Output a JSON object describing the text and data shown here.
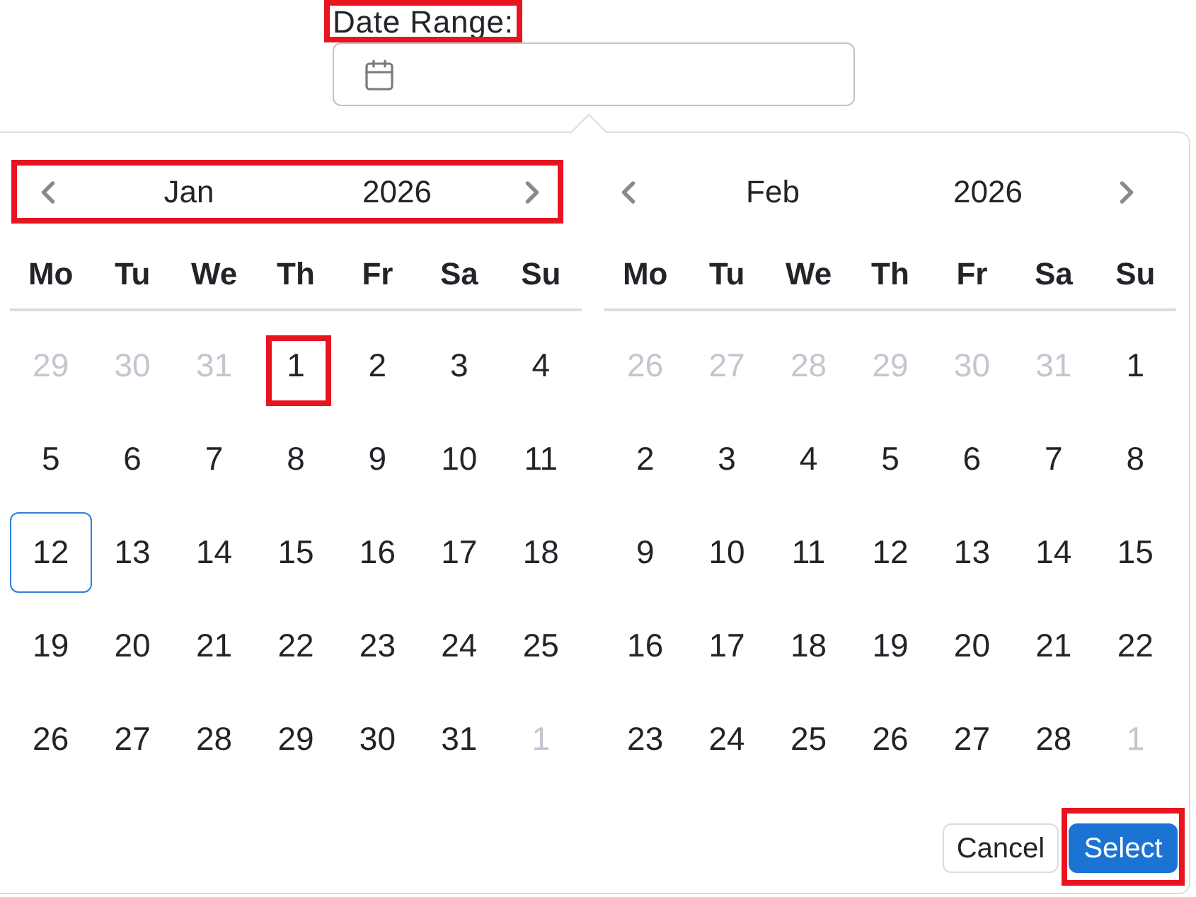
{
  "field": {
    "label": "Date Range:",
    "label_highlighted": true
  },
  "months": [
    {
      "month": "Jan",
      "year": "2026",
      "highlighted": true,
      "weekdays": [
        "Mo",
        "Tu",
        "We",
        "Th",
        "Fr",
        "Sa",
        "Su"
      ],
      "days": [
        {
          "day": "29",
          "outside": true,
          "current": false,
          "highlighted": false
        },
        {
          "day": "30",
          "outside": true,
          "current": false,
          "highlighted": false
        },
        {
          "day": "31",
          "outside": true,
          "current": false,
          "highlighted": false
        },
        {
          "day": "1",
          "outside": false,
          "current": false,
          "highlighted": true
        },
        {
          "day": "2",
          "outside": false,
          "current": false,
          "highlighted": false
        },
        {
          "day": "3",
          "outside": false,
          "current": false,
          "highlighted": false
        },
        {
          "day": "4",
          "outside": false,
          "current": false,
          "highlighted": false
        },
        {
          "day": "5",
          "outside": false,
          "current": false,
          "highlighted": false
        },
        {
          "day": "6",
          "outside": false,
          "current": false,
          "highlighted": false
        },
        {
          "day": "7",
          "outside": false,
          "current": false,
          "highlighted": false
        },
        {
          "day": "8",
          "outside": false,
          "current": false,
          "highlighted": false
        },
        {
          "day": "9",
          "outside": false,
          "current": false,
          "highlighted": false
        },
        {
          "day": "10",
          "outside": false,
          "current": false,
          "highlighted": false
        },
        {
          "day": "11",
          "outside": false,
          "current": false,
          "highlighted": false
        },
        {
          "day": "12",
          "outside": false,
          "current": true,
          "highlighted": false
        },
        {
          "day": "13",
          "outside": false,
          "current": false,
          "highlighted": false
        },
        {
          "day": "14",
          "outside": false,
          "current": false,
          "highlighted": false
        },
        {
          "day": "15",
          "outside": false,
          "current": false,
          "highlighted": false
        },
        {
          "day": "16",
          "outside": false,
          "current": false,
          "highlighted": false
        },
        {
          "day": "17",
          "outside": false,
          "current": false,
          "highlighted": false
        },
        {
          "day": "18",
          "outside": false,
          "current": false,
          "highlighted": false
        },
        {
          "day": "19",
          "outside": false,
          "current": false,
          "highlighted": false
        },
        {
          "day": "20",
          "outside": false,
          "current": false,
          "highlighted": false
        },
        {
          "day": "21",
          "outside": false,
          "current": false,
          "highlighted": false
        },
        {
          "day": "22",
          "outside": false,
          "current": false,
          "highlighted": false
        },
        {
          "day": "23",
          "outside": false,
          "current": false,
          "highlighted": false
        },
        {
          "day": "24",
          "outside": false,
          "current": false,
          "highlighted": false
        },
        {
          "day": "25",
          "outside": false,
          "current": false,
          "highlighted": false
        },
        {
          "day": "26",
          "outside": false,
          "current": false,
          "highlighted": false
        },
        {
          "day": "27",
          "outside": false,
          "current": false,
          "highlighted": false
        },
        {
          "day": "28",
          "outside": false,
          "current": false,
          "highlighted": false
        },
        {
          "day": "29",
          "outside": false,
          "current": false,
          "highlighted": false
        },
        {
          "day": "30",
          "outside": false,
          "current": false,
          "highlighted": false
        },
        {
          "day": "31",
          "outside": false,
          "current": false,
          "highlighted": false
        },
        {
          "day": "1",
          "outside": true,
          "current": false,
          "highlighted": false
        }
      ]
    },
    {
      "month": "Feb",
      "year": "2026",
      "highlighted": false,
      "weekdays": [
        "Mo",
        "Tu",
        "We",
        "Th",
        "Fr",
        "Sa",
        "Su"
      ],
      "days": [
        {
          "day": "26",
          "outside": true,
          "current": false,
          "highlighted": false
        },
        {
          "day": "27",
          "outside": true,
          "current": false,
          "highlighted": false
        },
        {
          "day": "28",
          "outside": true,
          "current": false,
          "highlighted": false
        },
        {
          "day": "29",
          "outside": true,
          "current": false,
          "highlighted": false
        },
        {
          "day": "30",
          "outside": true,
          "current": false,
          "highlighted": false
        },
        {
          "day": "31",
          "outside": true,
          "current": false,
          "highlighted": false
        },
        {
          "day": "1",
          "outside": false,
          "current": false,
          "highlighted": false
        },
        {
          "day": "2",
          "outside": false,
          "current": false,
          "highlighted": false
        },
        {
          "day": "3",
          "outside": false,
          "current": false,
          "highlighted": false
        },
        {
          "day": "4",
          "outside": false,
          "current": false,
          "highlighted": false
        },
        {
          "day": "5",
          "outside": false,
          "current": false,
          "highlighted": false
        },
        {
          "day": "6",
          "outside": false,
          "current": false,
          "highlighted": false
        },
        {
          "day": "7",
          "outside": false,
          "current": false,
          "highlighted": false
        },
        {
          "day": "8",
          "outside": false,
          "current": false,
          "highlighted": false
        },
        {
          "day": "9",
          "outside": false,
          "current": false,
          "highlighted": false
        },
        {
          "day": "10",
          "outside": false,
          "current": false,
          "highlighted": false
        },
        {
          "day": "11",
          "outside": false,
          "current": false,
          "highlighted": false
        },
        {
          "day": "12",
          "outside": false,
          "current": false,
          "highlighted": false
        },
        {
          "day": "13",
          "outside": false,
          "current": false,
          "highlighted": false
        },
        {
          "day": "14",
          "outside": false,
          "current": false,
          "highlighted": false
        },
        {
          "day": "15",
          "outside": false,
          "current": false,
          "highlighted": false
        },
        {
          "day": "16",
          "outside": false,
          "current": false,
          "highlighted": false
        },
        {
          "day": "17",
          "outside": false,
          "current": false,
          "highlighted": false
        },
        {
          "day": "18",
          "outside": false,
          "current": false,
          "highlighted": false
        },
        {
          "day": "19",
          "outside": false,
          "current": false,
          "highlighted": false
        },
        {
          "day": "20",
          "outside": false,
          "current": false,
          "highlighted": false
        },
        {
          "day": "21",
          "outside": false,
          "current": false,
          "highlighted": false
        },
        {
          "day": "22",
          "outside": false,
          "current": false,
          "highlighted": false
        },
        {
          "day": "23",
          "outside": false,
          "current": false,
          "highlighted": false
        },
        {
          "day": "24",
          "outside": false,
          "current": false,
          "highlighted": false
        },
        {
          "day": "25",
          "outside": false,
          "current": false,
          "highlighted": false
        },
        {
          "day": "26",
          "outside": false,
          "current": false,
          "highlighted": false
        },
        {
          "day": "27",
          "outside": false,
          "current": false,
          "highlighted": false
        },
        {
          "day": "28",
          "outside": false,
          "current": false,
          "highlighted": false
        },
        {
          "day": "1",
          "outside": true,
          "current": false,
          "highlighted": false
        }
      ]
    }
  ],
  "buttons": [
    {
      "label": "Cancel",
      "kind": "secondary",
      "highlighted": false
    },
    {
      "label": "Select",
      "kind": "primary",
      "highlighted": true
    }
  ]
}
